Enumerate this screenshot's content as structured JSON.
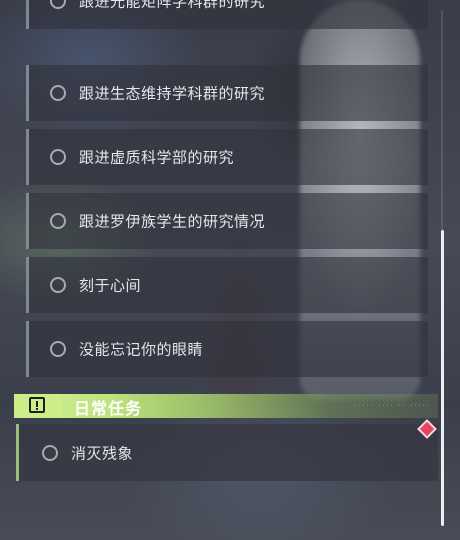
{
  "quests": [
    {
      "label": "跟进光能矩阵学科群的研究"
    },
    {
      "label": "跟进生态维持学科群的研究"
    },
    {
      "label": "跟进虚质科学部的研究"
    },
    {
      "label": "跟进罗伊族学生的研究情况"
    },
    {
      "label": "刻于心间"
    },
    {
      "label": "没能忘记你的眼睛"
    }
  ],
  "daily": {
    "title": "日常任务",
    "header_decoration": "····· ···· ·· ·····",
    "items": [
      {
        "label": "消灭残象"
      }
    ]
  },
  "colors": {
    "accent": "#cbee8a",
    "marker": "#e2455c",
    "item_bg": "#30323c"
  },
  "icons": {
    "status": "circle-icon",
    "section": "exclamation-icon",
    "tracking": "diamond-marker-icon"
  },
  "scroll": {
    "position_fraction": 0.42
  }
}
